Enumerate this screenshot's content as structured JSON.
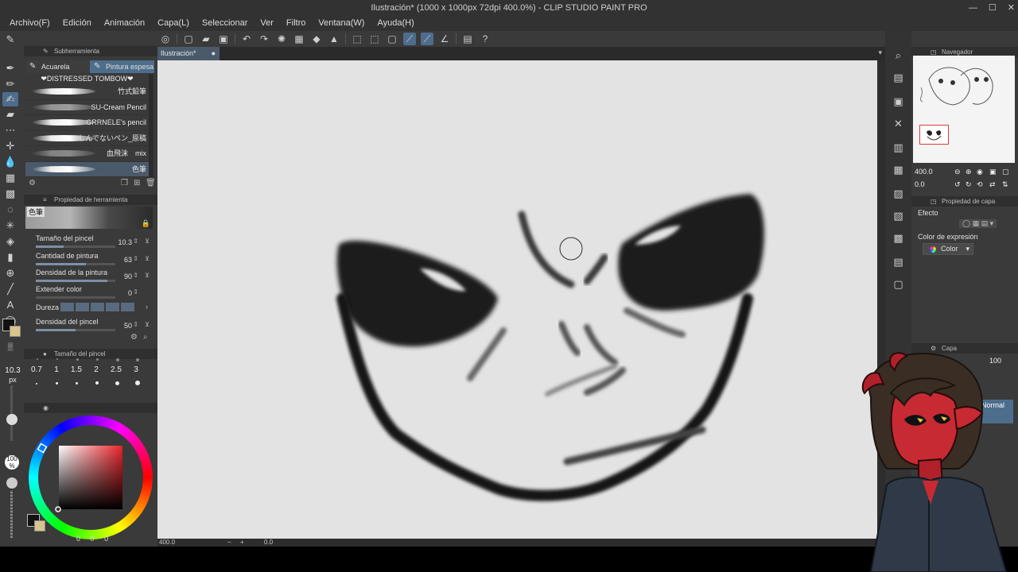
{
  "window": {
    "title": "Ilustración* (1000 x 1000px 72dpi 400.0%) - CLIP STUDIO PAINT PRO"
  },
  "menu": [
    "Archivo(F)",
    "Edición",
    "Animación",
    "Capa(L)",
    "Seleccionar",
    "Ver",
    "Filtro",
    "Ventana(W)",
    "Ayuda(H)"
  ],
  "document": {
    "tab_label": "Ilustración*"
  },
  "sub_tool_panel": {
    "title": "Subherramienta",
    "tabs": [
      "Acuarela",
      "Pintura espesa"
    ],
    "group_label": "❤DISTRESSED TOMBOW❤",
    "brushes": [
      "竹式鉛筆",
      "SU-Cream Pencil",
      "GRRNELE's pencil",
      "しんでないペン_原稿",
      "血飛沫　mix",
      "色筆"
    ],
    "selected_brush": "色筆"
  },
  "tool_property": {
    "title": "Propiedad de herramienta",
    "preview_label": "色筆",
    "rows": [
      {
        "label": "Tamaño del pincel",
        "value": "10.3",
        "level": 0.35
      },
      {
        "label": "Cantidad de pintura",
        "value": "63",
        "level": 0.63
      },
      {
        "label": "Densidad de la pintura",
        "value": "90",
        "level": 0.9
      },
      {
        "label": "Extender color",
        "value": "0",
        "level": 0
      },
      {
        "label": "Densidad del pincel",
        "value": "50",
        "level": 0.5
      }
    ],
    "hardness_label": "Dureza"
  },
  "brush_size_panel": {
    "title": "Tamaño del pincel",
    "presets": [
      "0.7",
      "1",
      "1.5",
      "2",
      "2.5",
      "3"
    ]
  },
  "left_slider": {
    "size_value": "10.3",
    "size_unit": "px",
    "opacity_value": "100",
    "opacity_unit": "%"
  },
  "color_panel": {
    "main_color": "#111111",
    "sub_color": "#d7c58d",
    "hue_color": "#e8242a",
    "values": [
      "0",
      "0",
      "0"
    ]
  },
  "status": {
    "zoom": "400.0",
    "angle": "0.0"
  },
  "navigator": {
    "title": "Navegador",
    "zoom": "400.0",
    "rotation": "0.0"
  },
  "layer_property": {
    "title": "Propiedad de capa",
    "effect_label": "Efecto",
    "expression_color_label": "Color de expresión",
    "color_option": "Color"
  },
  "layer_panel": {
    "title": "Capa",
    "opacity": "100",
    "blend_mode": "Normal"
  }
}
